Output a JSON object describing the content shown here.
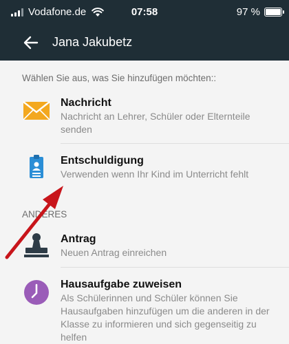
{
  "status_bar": {
    "carrier": "Vodafone.de",
    "time": "07:58",
    "battery": "97 %"
  },
  "header": {
    "title": "Jana Jakubetz"
  },
  "main": {
    "prompt": "Wählen Sie aus, was Sie hinzufügen möchten::",
    "items": [
      {
        "title": "Nachricht",
        "desc": "Nachricht an Lehrer, Schüler oder Elternteile senden",
        "icon": "envelope-icon",
        "color": "#f3a81f"
      },
      {
        "title": "Entschuldigung",
        "desc": "Verwenden wenn Ihr Kind im Unterricht fehlt",
        "icon": "id-badge-icon",
        "color": "#2b8ed6"
      }
    ],
    "other_section": "ANDERES",
    "other_items": [
      {
        "title": "Antrag",
        "desc": "Neuen Antrag einreichen",
        "icon": "stamp-icon",
        "color": "#2e3c47"
      },
      {
        "title": "Hausaufgabe zuweisen",
        "desc": "Als Schülerinnen und Schüler können Sie Hausaufgaben hinzufügen um die anderen in der Klasse zu informieren und sich gegenseitig zu helfen",
        "icon": "clock-icon",
        "color": "#9a5cb8"
      }
    ]
  },
  "annotation": {
    "arrow_color": "#c8151b"
  }
}
